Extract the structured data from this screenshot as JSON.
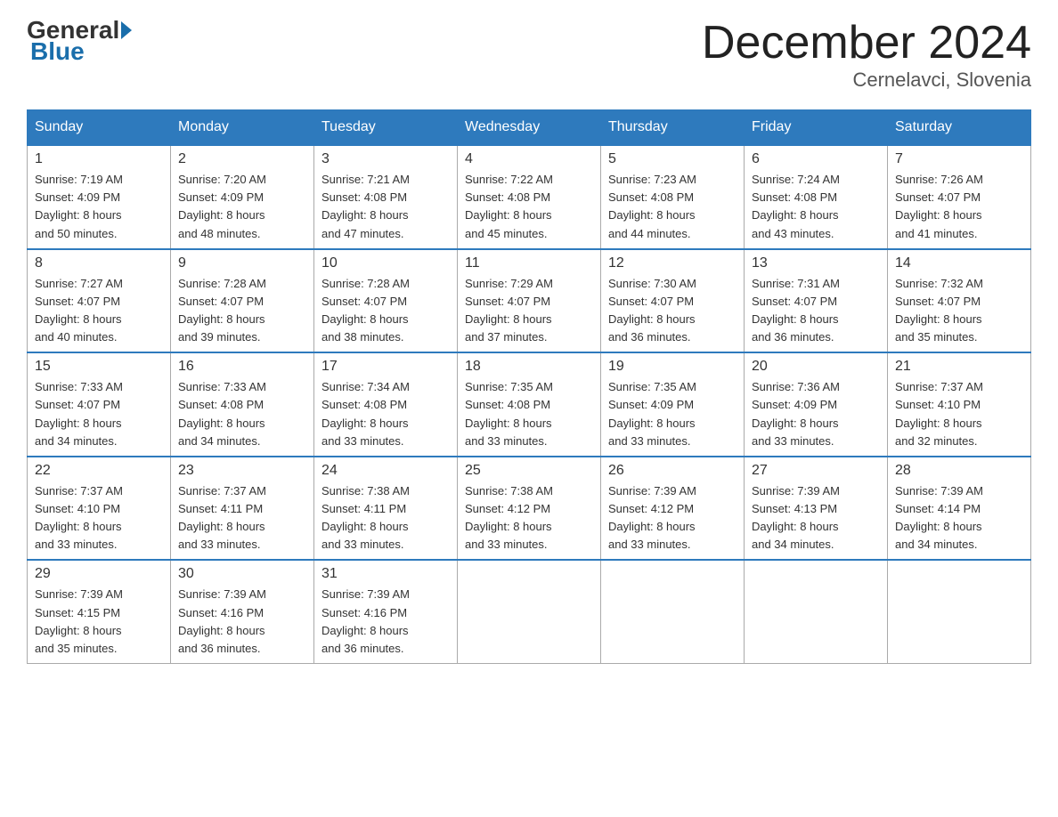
{
  "header": {
    "logo": {
      "general": "General",
      "blue": "Blue"
    },
    "title": "December 2024",
    "location": "Cernelavci, Slovenia"
  },
  "weekdays": [
    "Sunday",
    "Monday",
    "Tuesday",
    "Wednesday",
    "Thursday",
    "Friday",
    "Saturday"
  ],
  "weeks": [
    [
      {
        "day": "1",
        "sunrise": "7:19 AM",
        "sunset": "4:09 PM",
        "daylight": "8 hours and 50 minutes."
      },
      {
        "day": "2",
        "sunrise": "7:20 AM",
        "sunset": "4:09 PM",
        "daylight": "8 hours and 48 minutes."
      },
      {
        "day": "3",
        "sunrise": "7:21 AM",
        "sunset": "4:08 PM",
        "daylight": "8 hours and 47 minutes."
      },
      {
        "day": "4",
        "sunrise": "7:22 AM",
        "sunset": "4:08 PM",
        "daylight": "8 hours and 45 minutes."
      },
      {
        "day": "5",
        "sunrise": "7:23 AM",
        "sunset": "4:08 PM",
        "daylight": "8 hours and 44 minutes."
      },
      {
        "day": "6",
        "sunrise": "7:24 AM",
        "sunset": "4:08 PM",
        "daylight": "8 hours and 43 minutes."
      },
      {
        "day": "7",
        "sunrise": "7:26 AM",
        "sunset": "4:07 PM",
        "daylight": "8 hours and 41 minutes."
      }
    ],
    [
      {
        "day": "8",
        "sunrise": "7:27 AM",
        "sunset": "4:07 PM",
        "daylight": "8 hours and 40 minutes."
      },
      {
        "day": "9",
        "sunrise": "7:28 AM",
        "sunset": "4:07 PM",
        "daylight": "8 hours and 39 minutes."
      },
      {
        "day": "10",
        "sunrise": "7:28 AM",
        "sunset": "4:07 PM",
        "daylight": "8 hours and 38 minutes."
      },
      {
        "day": "11",
        "sunrise": "7:29 AM",
        "sunset": "4:07 PM",
        "daylight": "8 hours and 37 minutes."
      },
      {
        "day": "12",
        "sunrise": "7:30 AM",
        "sunset": "4:07 PM",
        "daylight": "8 hours and 36 minutes."
      },
      {
        "day": "13",
        "sunrise": "7:31 AM",
        "sunset": "4:07 PM",
        "daylight": "8 hours and 36 minutes."
      },
      {
        "day": "14",
        "sunrise": "7:32 AM",
        "sunset": "4:07 PM",
        "daylight": "8 hours and 35 minutes."
      }
    ],
    [
      {
        "day": "15",
        "sunrise": "7:33 AM",
        "sunset": "4:07 PM",
        "daylight": "8 hours and 34 minutes."
      },
      {
        "day": "16",
        "sunrise": "7:33 AM",
        "sunset": "4:08 PM",
        "daylight": "8 hours and 34 minutes."
      },
      {
        "day": "17",
        "sunrise": "7:34 AM",
        "sunset": "4:08 PM",
        "daylight": "8 hours and 33 minutes."
      },
      {
        "day": "18",
        "sunrise": "7:35 AM",
        "sunset": "4:08 PM",
        "daylight": "8 hours and 33 minutes."
      },
      {
        "day": "19",
        "sunrise": "7:35 AM",
        "sunset": "4:09 PM",
        "daylight": "8 hours and 33 minutes."
      },
      {
        "day": "20",
        "sunrise": "7:36 AM",
        "sunset": "4:09 PM",
        "daylight": "8 hours and 33 minutes."
      },
      {
        "day": "21",
        "sunrise": "7:37 AM",
        "sunset": "4:10 PM",
        "daylight": "8 hours and 32 minutes."
      }
    ],
    [
      {
        "day": "22",
        "sunrise": "7:37 AM",
        "sunset": "4:10 PM",
        "daylight": "8 hours and 33 minutes."
      },
      {
        "day": "23",
        "sunrise": "7:37 AM",
        "sunset": "4:11 PM",
        "daylight": "8 hours and 33 minutes."
      },
      {
        "day": "24",
        "sunrise": "7:38 AM",
        "sunset": "4:11 PM",
        "daylight": "8 hours and 33 minutes."
      },
      {
        "day": "25",
        "sunrise": "7:38 AM",
        "sunset": "4:12 PM",
        "daylight": "8 hours and 33 minutes."
      },
      {
        "day": "26",
        "sunrise": "7:39 AM",
        "sunset": "4:12 PM",
        "daylight": "8 hours and 33 minutes."
      },
      {
        "day": "27",
        "sunrise": "7:39 AM",
        "sunset": "4:13 PM",
        "daylight": "8 hours and 34 minutes."
      },
      {
        "day": "28",
        "sunrise": "7:39 AM",
        "sunset": "4:14 PM",
        "daylight": "8 hours and 34 minutes."
      }
    ],
    [
      {
        "day": "29",
        "sunrise": "7:39 AM",
        "sunset": "4:15 PM",
        "daylight": "8 hours and 35 minutes."
      },
      {
        "day": "30",
        "sunrise": "7:39 AM",
        "sunset": "4:16 PM",
        "daylight": "8 hours and 36 minutes."
      },
      {
        "day": "31",
        "sunrise": "7:39 AM",
        "sunset": "4:16 PM",
        "daylight": "8 hours and 36 minutes."
      },
      null,
      null,
      null,
      null
    ]
  ],
  "labels": {
    "sunrise": "Sunrise:",
    "sunset": "Sunset:",
    "daylight": "Daylight:"
  }
}
